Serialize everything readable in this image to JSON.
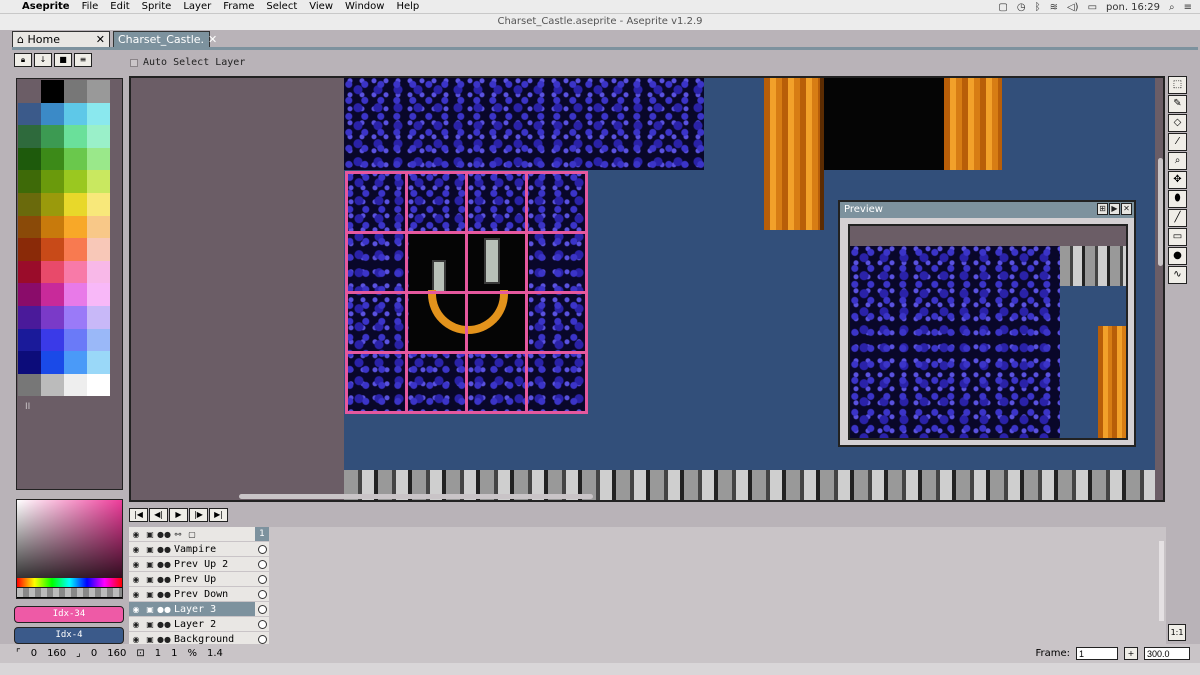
{
  "menubar": {
    "app": "Aseprite",
    "items": [
      "File",
      "Edit",
      "Sprite",
      "Layer",
      "Frame",
      "Select",
      "View",
      "Window",
      "Help"
    ],
    "clock": "pon. 16:29"
  },
  "window": {
    "title": "Charset_Castle.aseprite - Aseprite v1.2.9"
  },
  "tabs": [
    {
      "label": "Home"
    },
    {
      "label": "Charset_Castle."
    }
  ],
  "auto_select": {
    "label": "Auto Select Layer"
  },
  "palette": {
    "colors": [
      "#6b5d66",
      "#000000",
      "#777777",
      "#999999",
      "#3b5a8a",
      "#3b8ac7",
      "#5ec8e8",
      "#8ae8ee",
      "#2e6a3c",
      "#3c9a52",
      "#6ae09a",
      "#9af0c9",
      "#1e5a0c",
      "#3c8a18",
      "#6ac84c",
      "#9ae88a",
      "#3e6a08",
      "#6a9a0c",
      "#9ac820",
      "#c9e860",
      "#6a6a0c",
      "#9a9a0c",
      "#e8d82a",
      "#f8e87a",
      "#8a4a08",
      "#c87a0c",
      "#f8a828",
      "#f8c888",
      "#8a2a08",
      "#c84a18",
      "#f87a50",
      "#f8c8b8",
      "#9a0c2a",
      "#e84a6a",
      "#f87aa8",
      "#f8b8e8",
      "#8a0c6a",
      "#c82a9a",
      "#e87ae8",
      "#f8b8f8",
      "#4a1a9a",
      "#7a3ac8",
      "#9a7af8",
      "#c8b8f8",
      "#1a1a9a",
      "#3a3ae8",
      "#6a7af8",
      "#9ab8f8",
      "#0c0c7a",
      "#1a4ae8",
      "#4a9af8",
      "#9ad8f8",
      "#777777",
      "#bbbbbb",
      "#eeeeee",
      "#ffffff"
    ],
    "footer": "II"
  },
  "fg_color": {
    "label": "Idx-34",
    "hex": "#ee5aa6"
  },
  "bg_color": {
    "label": "Idx-4",
    "hex": "#3b5a8a"
  },
  "preview": {
    "title": "Preview"
  },
  "tools": [
    "marquee-icon",
    "pencil-icon",
    "eraser-icon",
    "eyedropper-icon",
    "zoom-icon",
    "move-icon",
    "fill-icon",
    "line-icon",
    "rectangle-icon",
    "blob-icon",
    "contour-icon"
  ],
  "timeline": {
    "frame_number": "1",
    "layers": [
      {
        "name": "Vampire",
        "selected": false
      },
      {
        "name": "Prev Up 2",
        "selected": false
      },
      {
        "name": "Prev Up",
        "selected": false
      },
      {
        "name": "Prev Down",
        "selected": false
      },
      {
        "name": "Layer 3",
        "selected": true
      },
      {
        "name": "Layer 2",
        "selected": false
      },
      {
        "name": "Background",
        "selected": false
      }
    ]
  },
  "status": {
    "pos_x": "0",
    "pos_y": "160",
    "size_w": "0",
    "size_h": "160",
    "frame": "1",
    "frame_count": "1",
    "zoom_ratio": "1.4",
    "frame_label": "Frame:",
    "frame_value": "1",
    "zoom_value": "300.0"
  }
}
